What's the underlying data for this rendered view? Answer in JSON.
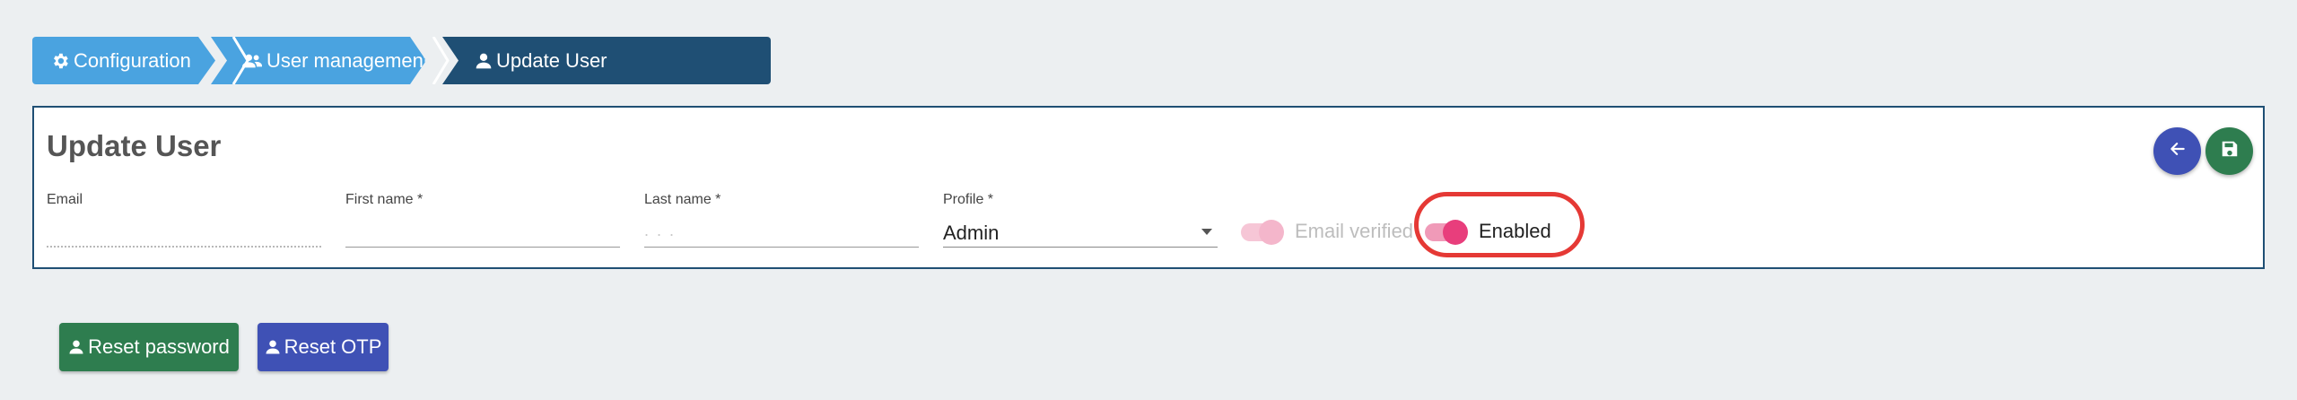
{
  "breadcrumb": {
    "items": [
      {
        "label": "Configuration",
        "icon": "gear-icon"
      },
      {
        "label": "User management",
        "icon": "users-icon"
      },
      {
        "label": "Update User",
        "icon": "user-icon"
      }
    ]
  },
  "form": {
    "title": "Update User",
    "email": {
      "label": "Email",
      "value": ""
    },
    "first_name": {
      "label": "First name *",
      "value": ""
    },
    "last_name": {
      "label": "Last name *",
      "value": ". . ."
    },
    "profile": {
      "label": "Profile *",
      "value": "Admin"
    },
    "email_verified": {
      "label": "Email verified",
      "checked": true,
      "disabled": true
    },
    "enabled": {
      "label": "Enabled",
      "checked": true
    }
  },
  "actions": {
    "back_icon": "arrow-left-icon",
    "save_icon": "floppy-disk-icon",
    "reset_password_label": "Reset password",
    "reset_otp_label": "Reset OTP"
  },
  "colors": {
    "breadcrumb_light": "#4aa3e0",
    "breadcrumb_dark": "#1f4f74",
    "toggle_pink": "#e83e7c",
    "primary_indigo": "#3f51b5",
    "success_green": "#2e7d4f",
    "highlight_red": "#e53935"
  }
}
